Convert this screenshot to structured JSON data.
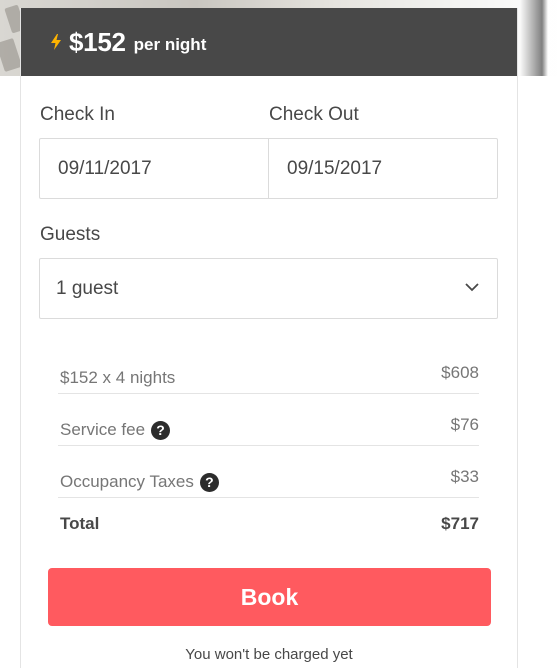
{
  "header": {
    "price": "$152",
    "price_unit": "per night",
    "accent_color": "#ffb400"
  },
  "dates": {
    "check_in_label": "Check In",
    "check_out_label": "Check Out",
    "check_in_value": "09/11/2017",
    "check_out_value": "09/15/2017"
  },
  "guests": {
    "label": "Guests",
    "selected": "1 guest"
  },
  "breakdown": {
    "nightly": {
      "label": "$152 x 4 nights",
      "value": "$608"
    },
    "service_fee": {
      "label": "Service fee",
      "value": "$76",
      "help_icon": "?"
    },
    "occupancy_taxes": {
      "label": "Occupancy Taxes",
      "value": "$33",
      "help_icon": "?"
    },
    "total": {
      "label": "Total",
      "value": "$717"
    }
  },
  "book_button": {
    "label": "Book",
    "color": "#ff5a5f"
  },
  "note": "You won't be charged yet"
}
